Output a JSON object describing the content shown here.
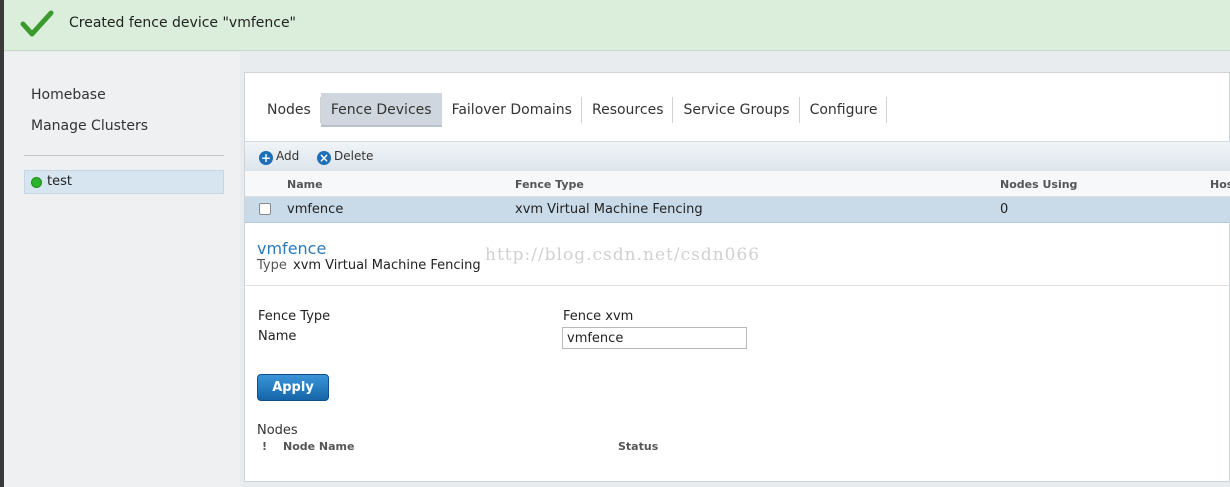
{
  "banner": {
    "message": "Created fence device \"vmfence\""
  },
  "sidebar": {
    "links": [
      {
        "label": "Homebase"
      },
      {
        "label": "Manage Clusters"
      }
    ],
    "clusters": [
      {
        "name": "test",
        "status_color": "#2bb32b"
      }
    ]
  },
  "tabs": [
    {
      "label": "Nodes"
    },
    {
      "label": "Fence Devices",
      "active": true
    },
    {
      "label": "Failover Domains"
    },
    {
      "label": "Resources"
    },
    {
      "label": "Service Groups"
    },
    {
      "label": "Configure"
    }
  ],
  "toolbar": {
    "add_label": "Add",
    "delete_label": "Delete"
  },
  "table": {
    "columns": [
      "Name",
      "Fence Type",
      "Nodes Using",
      "Hos"
    ],
    "rows": [
      {
        "name": "vmfence",
        "fence_type": "xvm Virtual Machine Fencing",
        "nodes_using": "0"
      }
    ]
  },
  "detail": {
    "title": "vmfence",
    "type_label": "Type",
    "type_value": "xvm Virtual Machine Fencing",
    "watermark": "http://blog.csdn.net/csdn066",
    "form": {
      "fence_type_label": "Fence Type",
      "fence_type_value": "Fence xvm",
      "name_label": "Name",
      "name_value": "vmfence"
    },
    "apply_label": "Apply",
    "nodes_heading": "Nodes",
    "nodes_columns": [
      "!",
      "Node Name",
      "Status"
    ]
  }
}
